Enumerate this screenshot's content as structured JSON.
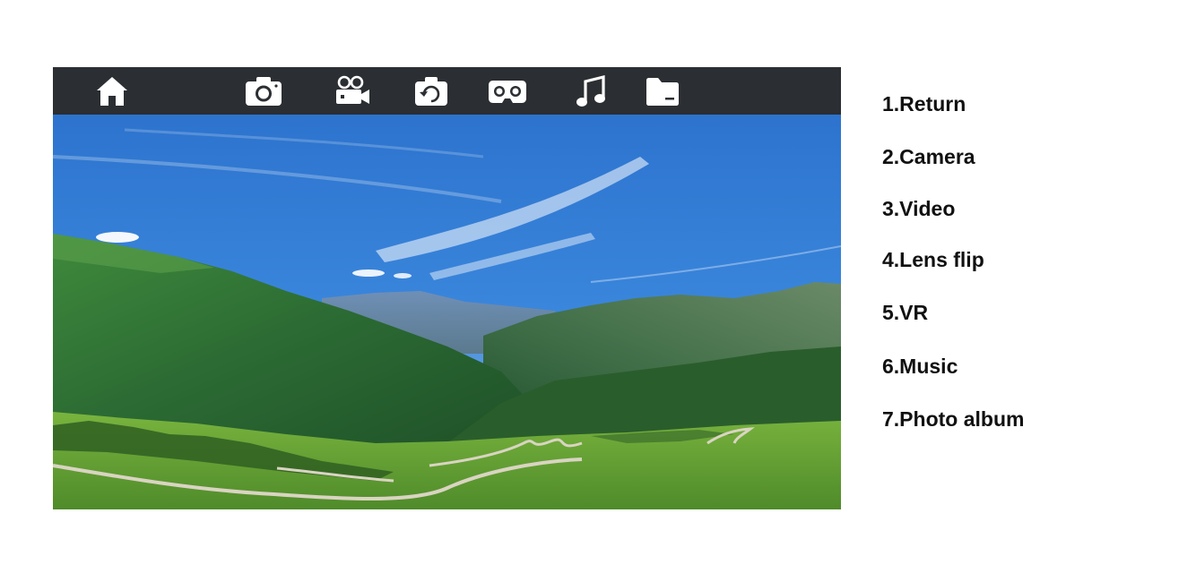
{
  "toolbar": {
    "buttons": [
      {
        "id": "return",
        "icon": "home-icon"
      },
      {
        "id": "camera",
        "icon": "camera-icon"
      },
      {
        "id": "video",
        "icon": "video-camera-icon"
      },
      {
        "id": "lens_flip",
        "icon": "lens-flip-icon"
      },
      {
        "id": "vr",
        "icon": "vr-headset-icon"
      },
      {
        "id": "music",
        "icon": "music-note-icon"
      },
      {
        "id": "photo_album",
        "icon": "folder-icon"
      }
    ],
    "background": "#2b2e32",
    "icon_color": "#ffffff"
  },
  "preview": {
    "content": "landscape-photo",
    "sky_color": "#2f78d2",
    "mountain_color": "#2e6a38",
    "grass_color": "#6ea83a"
  },
  "legend": {
    "items": [
      {
        "label": "1.Return"
      },
      {
        "label": "2.Camera"
      },
      {
        "label": "3.Video"
      },
      {
        "label": "4.Lens flip"
      },
      {
        "label": "5.VR"
      },
      {
        "label": "6.Music"
      },
      {
        "label": "7.Photo album"
      }
    ]
  }
}
